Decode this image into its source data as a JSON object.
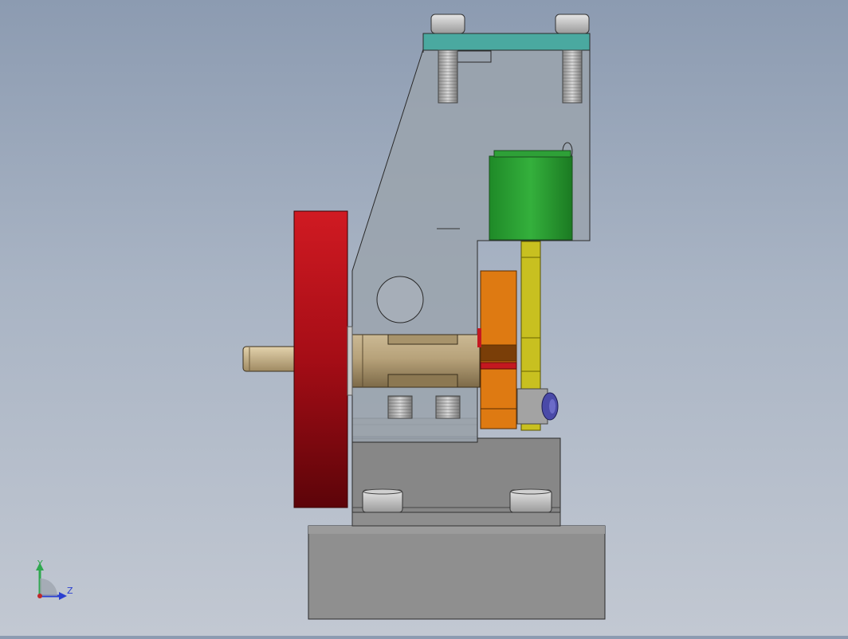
{
  "view": {
    "background_top": "#8c9bb1",
    "background_bottom": "#c2c8d2"
  },
  "triad": {
    "y_label": "Y",
    "z_label": "Z",
    "y_color": "#2fa84f",
    "z_color": "#2a3fd0",
    "origin_color": "#c0282a"
  },
  "parts": {
    "handwheel_color": "#b01018",
    "cam_color": "#e07a10",
    "green_block_color": "#22962c",
    "link_color": "#c8c020",
    "frame_color": "#9aa3ad",
    "top_plate_color": "#4aa9a0",
    "shaft_color": "#b09a70",
    "pin_cap_color": "#4a4aa8",
    "base_color": "#8d8d8d"
  }
}
